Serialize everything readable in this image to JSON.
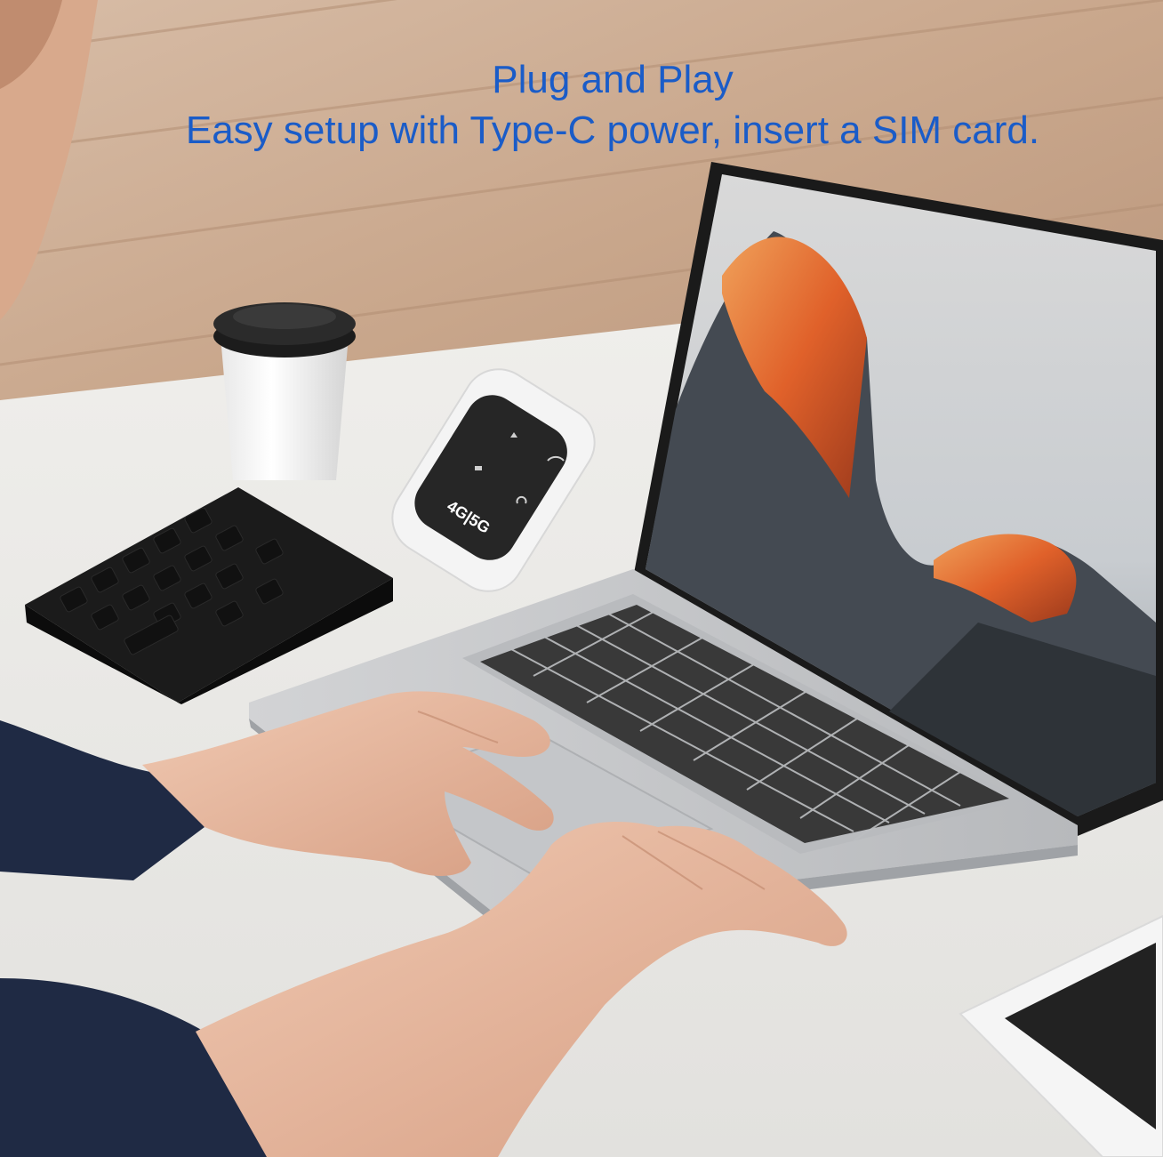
{
  "headline": {
    "line1": "Plug and Play",
    "line2": "Easy setup with Type-C power, insert a SIM card."
  },
  "device": {
    "label": "4G|5G"
  },
  "colors": {
    "headline": "#1a5cc8",
    "floor_wood": "#c9a98f",
    "desk": "#ecebe8",
    "laptop_body": "#c8c9cb",
    "screen_rock": "#e06a2c",
    "router_face": "#2b2b2b",
    "sleeve": "#1f2a44"
  },
  "icons": [
    "wifi-icon",
    "signal-icon",
    "sms-icon",
    "sync-icon"
  ]
}
